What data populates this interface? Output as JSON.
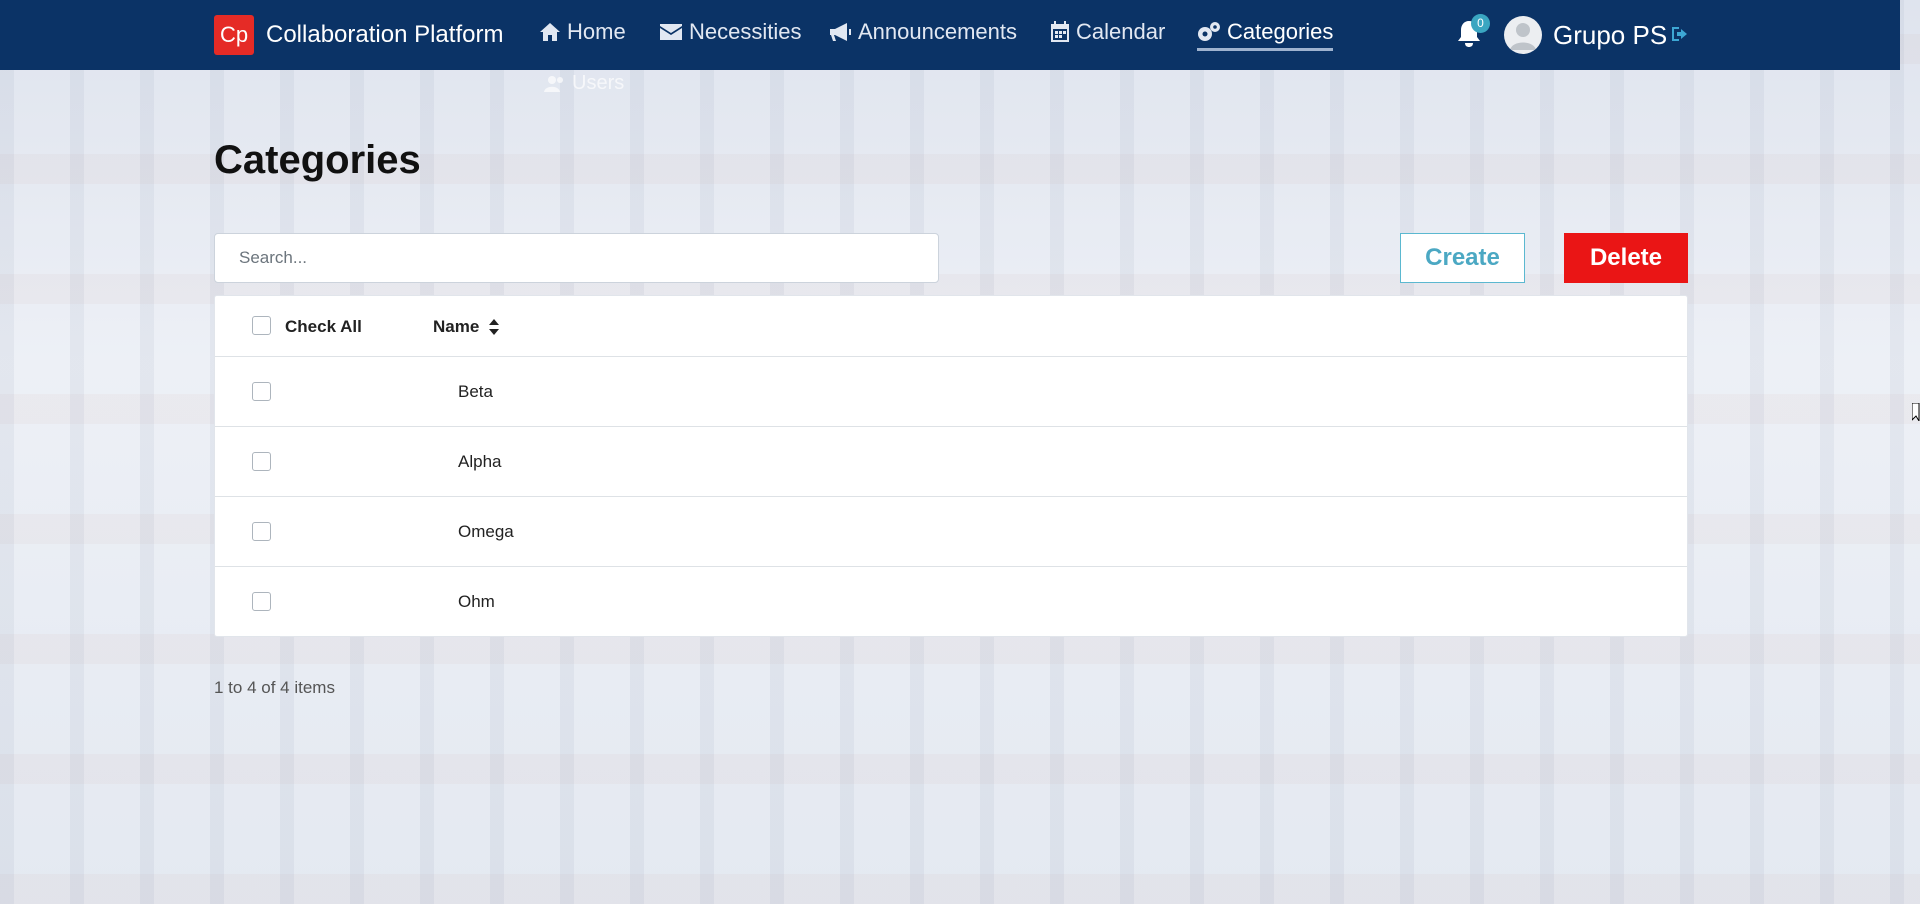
{
  "navbar": {
    "logo_text": "Cp",
    "brand": "Collaboration Platform",
    "items": [
      {
        "label": "Home",
        "icon": "home-icon"
      },
      {
        "label": "Necessities",
        "icon": "envelope-icon"
      },
      {
        "label": "Announcements",
        "icon": "bullhorn-icon"
      },
      {
        "label": "Calendar",
        "icon": "calendar-icon"
      },
      {
        "label": "Categories",
        "icon": "gears-icon",
        "active": true
      },
      {
        "label": "Users",
        "icon": "users-icon"
      }
    ],
    "notification_count": "0",
    "user_name": "Grupo PS"
  },
  "page": {
    "title": "Categories",
    "search_placeholder": "Search...",
    "create_label": "Create",
    "delete_label": "Delete"
  },
  "table": {
    "check_all_label": "Check All",
    "name_header": "Name",
    "rows": [
      {
        "name": "Beta"
      },
      {
        "name": "Alpha"
      },
      {
        "name": "Omega"
      },
      {
        "name": "Ohm"
      }
    ]
  },
  "pagination": {
    "info": "1 to 4 of 4 items"
  },
  "colors": {
    "navbar": "#0b3366",
    "logo": "#e52b26",
    "create": "#4ba8c3",
    "delete": "#ea1515",
    "badge": "#3aa6c1"
  }
}
